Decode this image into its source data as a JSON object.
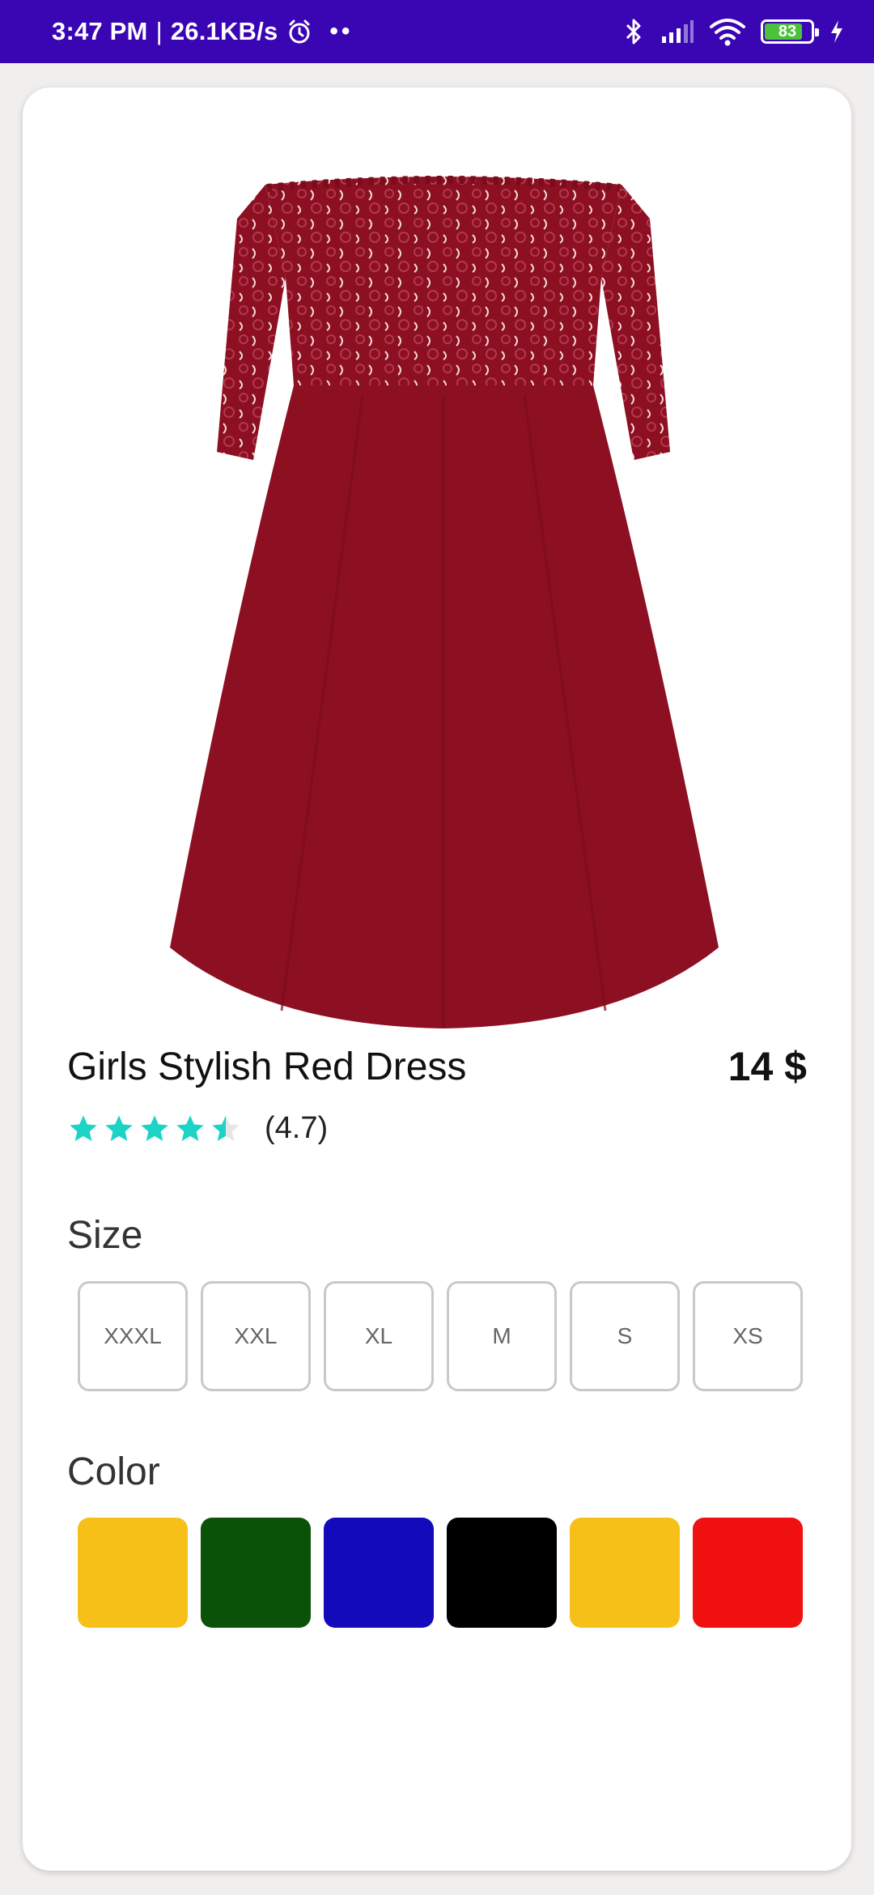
{
  "status_bar": {
    "time": "3:47 PM",
    "separator": "|",
    "net_speed": "26.1KB/s",
    "battery": "83",
    "battery_level": 0.83
  },
  "product": {
    "title": "Girls Stylish Red Dress",
    "price": "14 $",
    "rating_text": "(4.7)",
    "rating_value": 4.7,
    "rating_max": 5
  },
  "size_section": {
    "label": "Size",
    "options": [
      "XXXL",
      "XXL",
      "XL",
      "M",
      "S",
      "XS"
    ]
  },
  "color_section": {
    "label": "Color",
    "swatches": [
      "#f7c018",
      "#0a5208",
      "#130bbb",
      "#000000",
      "#f7c018",
      "#f01010"
    ]
  },
  "colors": {
    "status_bar": "#3a06b4",
    "star": "#1cd3c6",
    "dress": "#8c0f22"
  }
}
